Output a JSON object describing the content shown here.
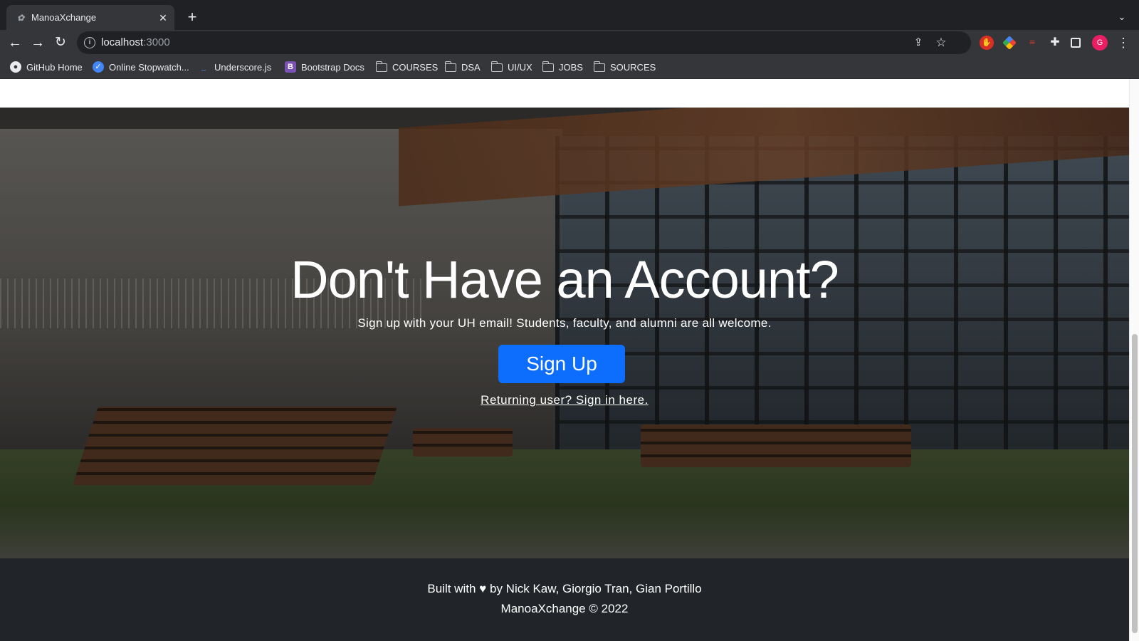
{
  "browser": {
    "tab": {
      "title": "ManoaXchange",
      "favicon": "manoaxchange-favicon"
    },
    "new_tab_symbol": "+",
    "close_symbol": "✕",
    "omnibox": {
      "host": "localhost",
      "port": ":3000"
    },
    "profile_initial": "G"
  },
  "bookmarks": [
    {
      "label": "GitHub Home",
      "icon": "github-icon"
    },
    {
      "label": "Online Stopwatch...",
      "icon": "check-circle-icon"
    },
    {
      "label": "Underscore.js",
      "icon": "underscore-icon"
    },
    {
      "label": "Bootstrap Docs",
      "icon": "bootstrap-icon",
      "icon_text": "B"
    },
    {
      "label": "COURSES",
      "icon": "folder-icon"
    },
    {
      "label": "DSA",
      "icon": "folder-icon"
    },
    {
      "label": "UI/UX",
      "icon": "folder-icon"
    },
    {
      "label": "JOBS",
      "icon": "folder-icon"
    },
    {
      "label": "SOURCES",
      "icon": "folder-icon"
    }
  ],
  "hero": {
    "title": "Don't Have an Account?",
    "subtitle": "Sign up with your UH email! Students, faculty, and alumni are all welcome.",
    "signup_label": "Sign Up",
    "signin_label": "Returning user? Sign in here."
  },
  "footer": {
    "line1_prefix": "Built with",
    "heart": "♥",
    "line1_suffix": "by Nick Kaw,  Giorgio Tran,  Gian Portillo",
    "line2": "ManoaXchange © 2022"
  },
  "colors": {
    "primary_button": "#0d6efd",
    "footer_bg": "#212529",
    "chrome_bg": "#202124",
    "toolbar_bg": "#35363a",
    "profile_avatar": "#e91e63"
  }
}
